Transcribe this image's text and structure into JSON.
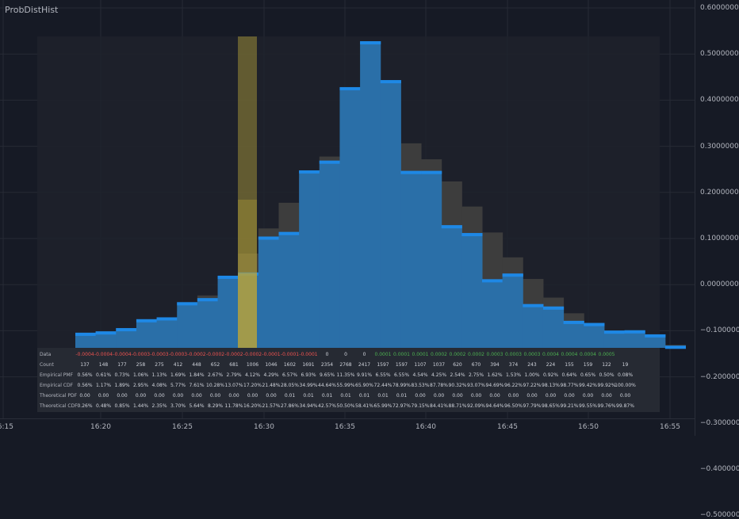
{
  "indicator": {
    "title": "ProbDistHist"
  },
  "colors": {
    "background": "#161a25",
    "panel": "#1f222b",
    "grid": "#262a35",
    "empirical_bar": "#2a6fa8",
    "empirical_cap": "#1e88e5",
    "theoretical_bar": "#3d3d3d",
    "highlight": "#b8a33a",
    "negative_text": "#ef5350",
    "positive_text": "#4caf50",
    "neutral_text": "#d1d4dc"
  },
  "price_axis": {
    "labels": [
      "0.60000000",
      "0.50000000",
      "0.40000000",
      "0.30000000",
      "0.20000000",
      "0.10000000",
      "0.00000000",
      "−0.10000000",
      "−0.20000000",
      "−0.30000000",
      "−0.40000000",
      "−0.50000000"
    ]
  },
  "time_axis": {
    "labels": [
      "16:15",
      "16:20",
      "16:25",
      "16:30",
      "16:35",
      "16:40",
      "16:45",
      "16:50",
      "16:55"
    ]
  },
  "chart_data": {
    "type": "bar",
    "highlight_bin_index": 11,
    "bins_count": 30,
    "empirical_pmf_percent": [
      0.56,
      0.61,
      0.73,
      1.06,
      1.13,
      1.69,
      1.84,
      2.67,
      2.79,
      4.12,
      4.29,
      6.57,
      6.93,
      9.65,
      11.35,
      9.91,
      6.55,
      6.55,
      4.54,
      4.25,
      2.54,
      2.75,
      1.62,
      1.53,
      1.0,
      0.92,
      0.64,
      0.65,
      0.5,
      0.08
    ],
    "theoretical_pdf_percent": [
      0.26,
      0.22,
      0.37,
      0.59,
      0.91,
      1.35,
      1.94,
      2.65,
      3.49,
      4.42,
      5.37,
      6.29,
      7.08,
      7.63,
      7.93,
      7.91,
      7.57,
      6.98,
      6.16,
      5.23,
      4.27,
      3.35,
      2.55,
      1.86,
      1.28,
      0.86,
      0.56,
      0.34,
      0.21,
      0.11
    ],
    "price_ticks": [
      0.6,
      0.5,
      0.4,
      0.3,
      0.2,
      0.1,
      0.0,
      -0.1,
      -0.2,
      -0.3,
      -0.4,
      -0.5
    ]
  },
  "stats_table": {
    "rows": [
      {
        "label": "Data",
        "values": [
          "-0.0004",
          "-0.0004",
          "-0.0004",
          "-0.0003",
          "-0.0003",
          "-0.0003",
          "-0.0002",
          "-0.0002",
          "-0.0002",
          "-0.0002",
          "-0.0001",
          "-0.0001",
          "-0.0001",
          "0",
          "0",
          "0",
          "0.0001",
          "0.0001",
          "0.0001",
          "0.0002",
          "0.0002",
          "0.0002",
          "0.0003",
          "0.0003",
          "0.0003",
          "0.0004",
          "0.0004",
          "0.0004",
          "0.0005"
        ]
      },
      {
        "label": "Count",
        "values": [
          "137",
          "148",
          "177",
          "258",
          "275",
          "412",
          "448",
          "652",
          "681",
          "1006",
          "1046",
          "1602",
          "1691",
          "2354",
          "2768",
          "2417",
          "1597",
          "1597",
          "1107",
          "1037",
          "620",
          "670",
          "394",
          "374",
          "243",
          "224",
          "155",
          "159",
          "122",
          "19"
        ]
      },
      {
        "label": "Empirical PMF",
        "values": [
          "0.56%",
          "0.61%",
          "0.73%",
          "1.06%",
          "1.13%",
          "1.69%",
          "1.84%",
          "2.67%",
          "2.79%",
          "4.12%",
          "4.29%",
          "6.57%",
          "6.93%",
          "9.65%",
          "11.35%",
          "9.91%",
          "6.55%",
          "6.55%",
          "4.54%",
          "4.25%",
          "2.54%",
          "2.75%",
          "1.62%",
          "1.53%",
          "1.00%",
          "0.92%",
          "0.64%",
          "0.65%",
          "0.50%",
          "0.08%"
        ]
      },
      {
        "label": "Empirical CDF",
        "values": [
          "0.56%",
          "1.17%",
          "1.89%",
          "2.95%",
          "4.08%",
          "5.77%",
          "7.61%",
          "10.28%",
          "13.07%",
          "17.20%",
          "21.48%",
          "28.05%",
          "34.99%",
          "44.64%",
          "55.99%",
          "65.90%",
          "72.44%",
          "78.99%",
          "83.53%",
          "87.78%",
          "90.32%",
          "93.07%",
          "94.69%",
          "96.22%",
          "97.22%",
          "98.13%",
          "98.77%",
          "99.42%",
          "99.92%",
          "100.00%"
        ]
      },
      {
        "label": "Theoretical PDF",
        "values": [
          "0.00",
          "0.00",
          "0.00",
          "0.00",
          "0.00",
          "0.00",
          "0.00",
          "0.00",
          "0.00",
          "0.00",
          "0.00",
          "0.01",
          "0.01",
          "0.01",
          "0.01",
          "0.01",
          "0.01",
          "0.01",
          "0.00",
          "0.00",
          "0.00",
          "0.00",
          "0.00",
          "0.00",
          "0.00",
          "0.00",
          "0.00",
          "0.00",
          "0.00",
          "0.00"
        ]
      },
      {
        "label": "Theoretical CDF",
        "values": [
          "0.26%",
          "0.48%",
          "0.85%",
          "1.44%",
          "2.35%",
          "3.70%",
          "5.64%",
          "8.29%",
          "11.78%",
          "16.20%",
          "21.57%",
          "27.86%",
          "34.94%",
          "42.57%",
          "50.50%",
          "58.41%",
          "65.99%",
          "72.97%",
          "79.15%",
          "84.41%",
          "88.71%",
          "92.09%",
          "94.64%",
          "96.50%",
          "97.79%",
          "98.65%",
          "99.21%",
          "99.55%",
          "99.76%",
          "99.87%"
        ]
      }
    ]
  }
}
